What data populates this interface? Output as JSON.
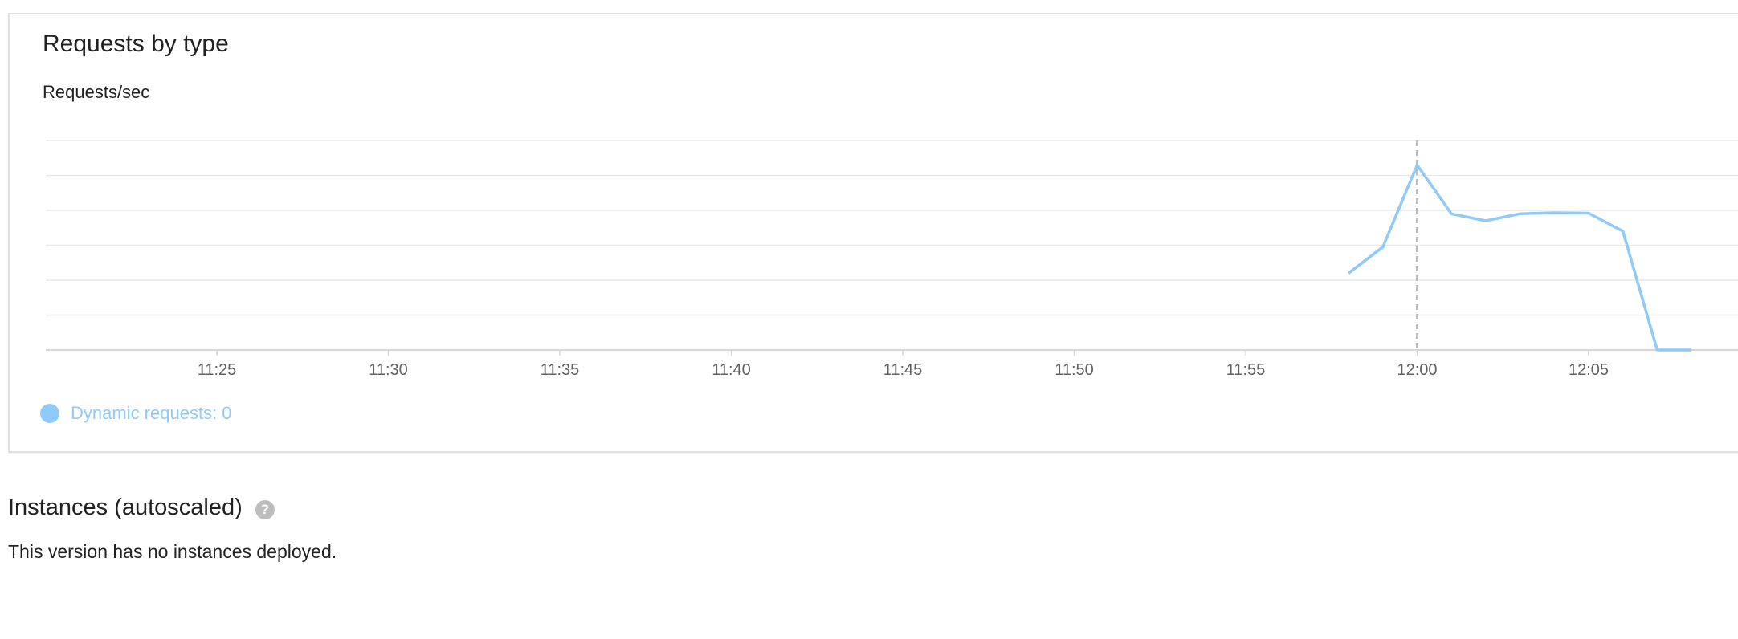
{
  "card": {
    "title": "Requests by type"
  },
  "chart_data": {
    "type": "line",
    "ylabel": "Requests/sec",
    "x_ticks": [
      "11:25",
      "11:30",
      "11:35",
      "11:40",
      "11:45",
      "11:50",
      "11:55",
      "12:00",
      "12:05"
    ],
    "x_range": [
      "11:20",
      "12:10"
    ],
    "ylim": [
      0,
      6
    ],
    "grid": true,
    "y_tick_labels_shown": false,
    "hover_marker_x": "12:00",
    "legend_position": "bottom-left",
    "series": [
      {
        "name": "Dynamic requests",
        "color": "#90caf9",
        "x": [
          "11:58",
          "11:59",
          "12:00",
          "12:01",
          "12:02",
          "12:03",
          "12:04",
          "12:05",
          "12:06",
          "12:07",
          "12:08"
        ],
        "values": [
          2.2,
          2.95,
          5.3,
          3.9,
          3.7,
          3.9,
          3.93,
          3.92,
          3.4,
          0,
          0
        ]
      }
    ]
  },
  "legend": {
    "label": "Dynamic requests: 0",
    "color": "#90caf9"
  },
  "instances": {
    "title": "Instances (autoscaled)",
    "help_icon": "help-icon",
    "help_glyph": "?",
    "message": "This version has no instances deployed."
  }
}
